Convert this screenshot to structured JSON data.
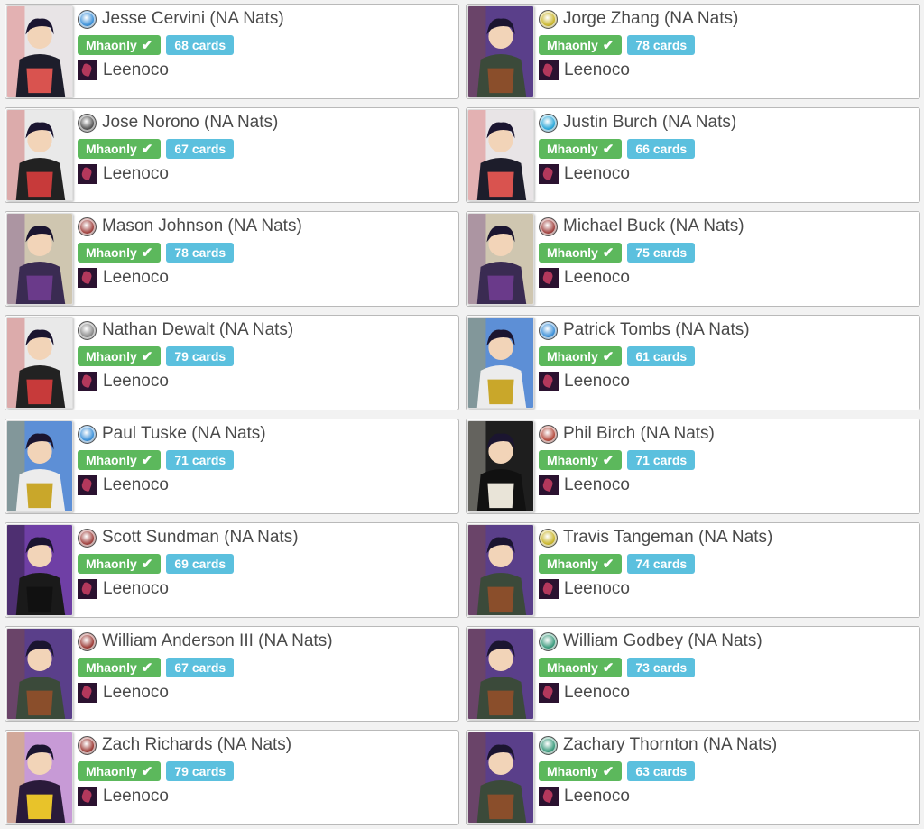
{
  "cards": [
    {
      "player": "Jesse Cervini (NA Nats)",
      "format": "Mhaonly",
      "cards": "68 cards",
      "character": "Leenoco",
      "symbol_icon": "air-symbol-icon",
      "symbol_color": "#3a8fd8",
      "portrait": "jirou-portrait-icon",
      "bg": "#e8e4e6",
      "accent": "#d9534f",
      "body": "#1d1d2b"
    },
    {
      "player": "Jorge Zhang (NA Nats)",
      "format": "Mhaonly",
      "cards": "78 cards",
      "character": "Leenoco",
      "symbol_icon": "order-symbol-icon",
      "symbol_color": "#c9b52a",
      "portrait": "overhaul-portrait-icon",
      "bg": "#5a3f8a",
      "accent": "#8a4e2b",
      "body": "#3b4a3a"
    },
    {
      "player": "Jose Norono (NA Nats)",
      "format": "Mhaonly",
      "cards": "67 cards",
      "character": "Leenoco",
      "symbol_icon": "death-symbol-icon",
      "symbol_color": "#555555",
      "portrait": "aizawa-portrait-icon",
      "bg": "#e9e9e9",
      "accent": "#c73a3a",
      "body": "#222222"
    },
    {
      "player": "Justin Burch (NA Nats)",
      "format": "Mhaonly",
      "cards": "66 cards",
      "character": "Leenoco",
      "symbol_icon": "water-symbol-icon",
      "symbol_color": "#2aa7d8",
      "portrait": "jirou-portrait-icon",
      "bg": "#e8e4e6",
      "accent": "#d9534f",
      "body": "#1d1d2b"
    },
    {
      "player": "Mason Johnson (NA Nats)",
      "format": "Mhaonly",
      "cards": "78 cards",
      "character": "Leenoco",
      "symbol_icon": "chaos-symbol-icon",
      "symbol_color": "#a0423f",
      "portrait": "tamaki-portrait-icon",
      "bg": "#cfc6b0",
      "accent": "#6a3a8a",
      "body": "#3a2b52"
    },
    {
      "player": "Michael Buck (NA Nats)",
      "format": "Mhaonly",
      "cards": "75 cards",
      "character": "Leenoco",
      "symbol_icon": "chaos-symbol-icon",
      "symbol_color": "#a0423f",
      "portrait": "tamaki-portrait-icon",
      "bg": "#cfc6b0",
      "accent": "#6a3a8a",
      "body": "#3a2b52"
    },
    {
      "player": "Nathan Dewalt (NA Nats)",
      "format": "Mhaonly",
      "cards": "79 cards",
      "character": "Leenoco",
      "symbol_icon": "void-symbol-icon",
      "symbol_color": "#8a8a8a",
      "portrait": "aizawa-portrait-icon",
      "bg": "#e9e9e9",
      "accent": "#c73a3a",
      "body": "#222222"
    },
    {
      "player": "Patrick Tombs (NA Nats)",
      "format": "Mhaonly",
      "cards": "61 cards",
      "character": "Leenoco",
      "symbol_icon": "air-symbol-icon",
      "symbol_color": "#3a8fd8",
      "portrait": "mirio-portrait-icon",
      "bg": "#5d8fd6",
      "accent": "#c9a72a",
      "body": "#ececec"
    },
    {
      "player": "Paul Tuske (NA Nats)",
      "format": "Mhaonly",
      "cards": "71 cards",
      "character": "Leenoco",
      "symbol_icon": "air-symbol-icon",
      "symbol_color": "#3a8fd8",
      "portrait": "mirio-portrait-icon",
      "bg": "#5d8fd6",
      "accent": "#c9a72a",
      "body": "#ececec"
    },
    {
      "player": "Phil Birch (NA Nats)",
      "format": "Mhaonly",
      "cards": "71 cards",
      "character": "Leenoco",
      "symbol_icon": "fire-symbol-icon",
      "symbol_color": "#b3493c",
      "portrait": "chronostasis-portrait-icon",
      "bg": "#1e1e1e",
      "accent": "#e9e4d8",
      "body": "#111111"
    },
    {
      "player": "Scott Sundman (NA Nats)",
      "format": "Mhaonly",
      "cards": "69 cards",
      "character": "Leenoco",
      "symbol_icon": "chaos-symbol-icon",
      "symbol_color": "#a0423f",
      "portrait": "allforone-portrait-icon",
      "bg": "#6f3fa5",
      "accent": "#111111",
      "body": "#1a1a1a"
    },
    {
      "player": "Travis Tangeman (NA Nats)",
      "format": "Mhaonly",
      "cards": "74 cards",
      "character": "Leenoco",
      "symbol_icon": "order-symbol-icon",
      "symbol_color": "#c9b52a",
      "portrait": "overhaul-portrait-icon",
      "bg": "#5a3f8a",
      "accent": "#8a4e2b",
      "body": "#3b4a3a"
    },
    {
      "player": "William Anderson III (NA Nats)",
      "format": "Mhaonly",
      "cards": "67 cards",
      "character": "Leenoco",
      "symbol_icon": "fire-symbol-icon",
      "symbol_color": "#9c3b36",
      "portrait": "overhaul-portrait-icon",
      "bg": "#5a3f8a",
      "accent": "#8a4e2b",
      "body": "#3b4a3a"
    },
    {
      "player": "William Godbey (NA Nats)",
      "format": "Mhaonly",
      "cards": "73 cards",
      "character": "Leenoco",
      "symbol_icon": "life-symbol-icon",
      "symbol_color": "#3a9a7c",
      "portrait": "overhaul-portrait-icon",
      "bg": "#5a3f8a",
      "accent": "#8a4e2b",
      "body": "#3b4a3a"
    },
    {
      "player": "Zach Richards (NA Nats)",
      "format": "Mhaonly",
      "cards": "79 cards",
      "character": "Leenoco",
      "symbol_icon": "fire-symbol-icon",
      "symbol_color": "#9c3b36",
      "portrait": "mineta-portrait-icon",
      "bg": "#c79ad6",
      "accent": "#e8c32a",
      "body": "#2a1a3a"
    },
    {
      "player": "Zachary Thornton (NA Nats)",
      "format": "Mhaonly",
      "cards": "63 cards",
      "character": "Leenoco",
      "symbol_icon": "life-symbol-icon",
      "symbol_color": "#3a9a7c",
      "portrait": "overhaul-portrait-icon",
      "bg": "#5a3f8a",
      "accent": "#8a4e2b",
      "body": "#3b4a3a"
    }
  ],
  "check_glyph": "✔"
}
